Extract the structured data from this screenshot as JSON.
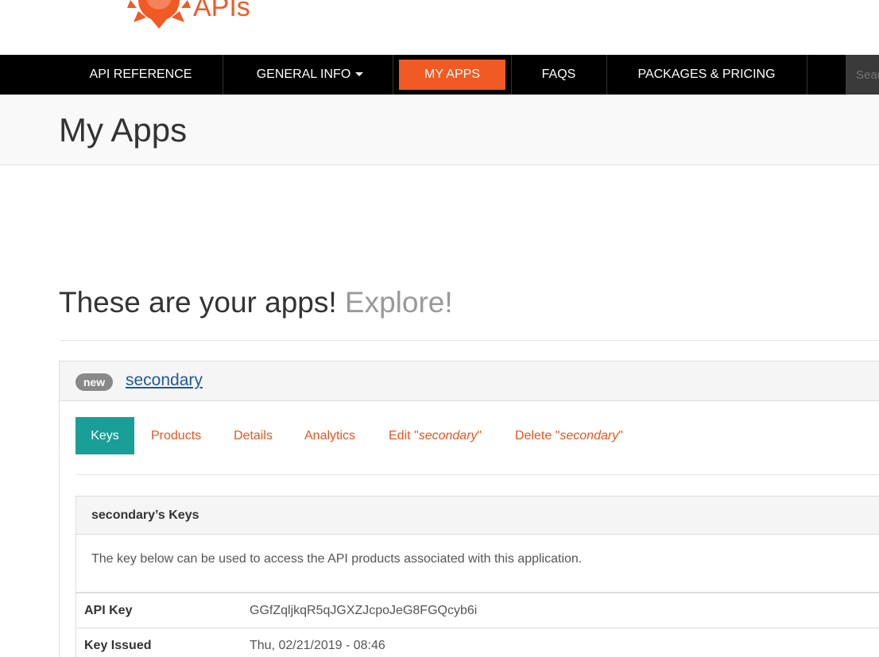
{
  "brand": {
    "logo_text": "APIs",
    "accent": "#f15a24"
  },
  "nav": {
    "items": [
      {
        "label": "API REFERENCE"
      },
      {
        "label": "GENERAL INFO"
      },
      {
        "label": "MY APPS"
      },
      {
        "label": "FAQS"
      },
      {
        "label": "PACKAGES & PRICING"
      }
    ],
    "active_index": 2,
    "search_placeholder": "Search"
  },
  "page": {
    "title": "My Apps"
  },
  "heading": {
    "main": "These are your apps!",
    "muted": "Explore!"
  },
  "app": {
    "badge": "new",
    "name": "secondary",
    "tabs": [
      {
        "label": "Keys"
      },
      {
        "label": "Products"
      },
      {
        "label": "Details"
      },
      {
        "label": "Analytics"
      },
      {
        "prefix": "Edit \"",
        "name": "secondary",
        "suffix": "\""
      },
      {
        "prefix": "Delete \"",
        "name": "secondary",
        "suffix": "\""
      }
    ],
    "active_tab_color": "#1a9e98",
    "keys": {
      "title": "secondary’s Keys",
      "description": "The key below can be used to access the API products associated with this application.",
      "rows": [
        {
          "label": "API Key",
          "value": "GGfZqljkqR5qJGXZJcpoJeG8FGQcyb6i"
        },
        {
          "label": "Key Issued",
          "value": "Thu, 02/21/2019 - 08:46"
        }
      ]
    }
  }
}
